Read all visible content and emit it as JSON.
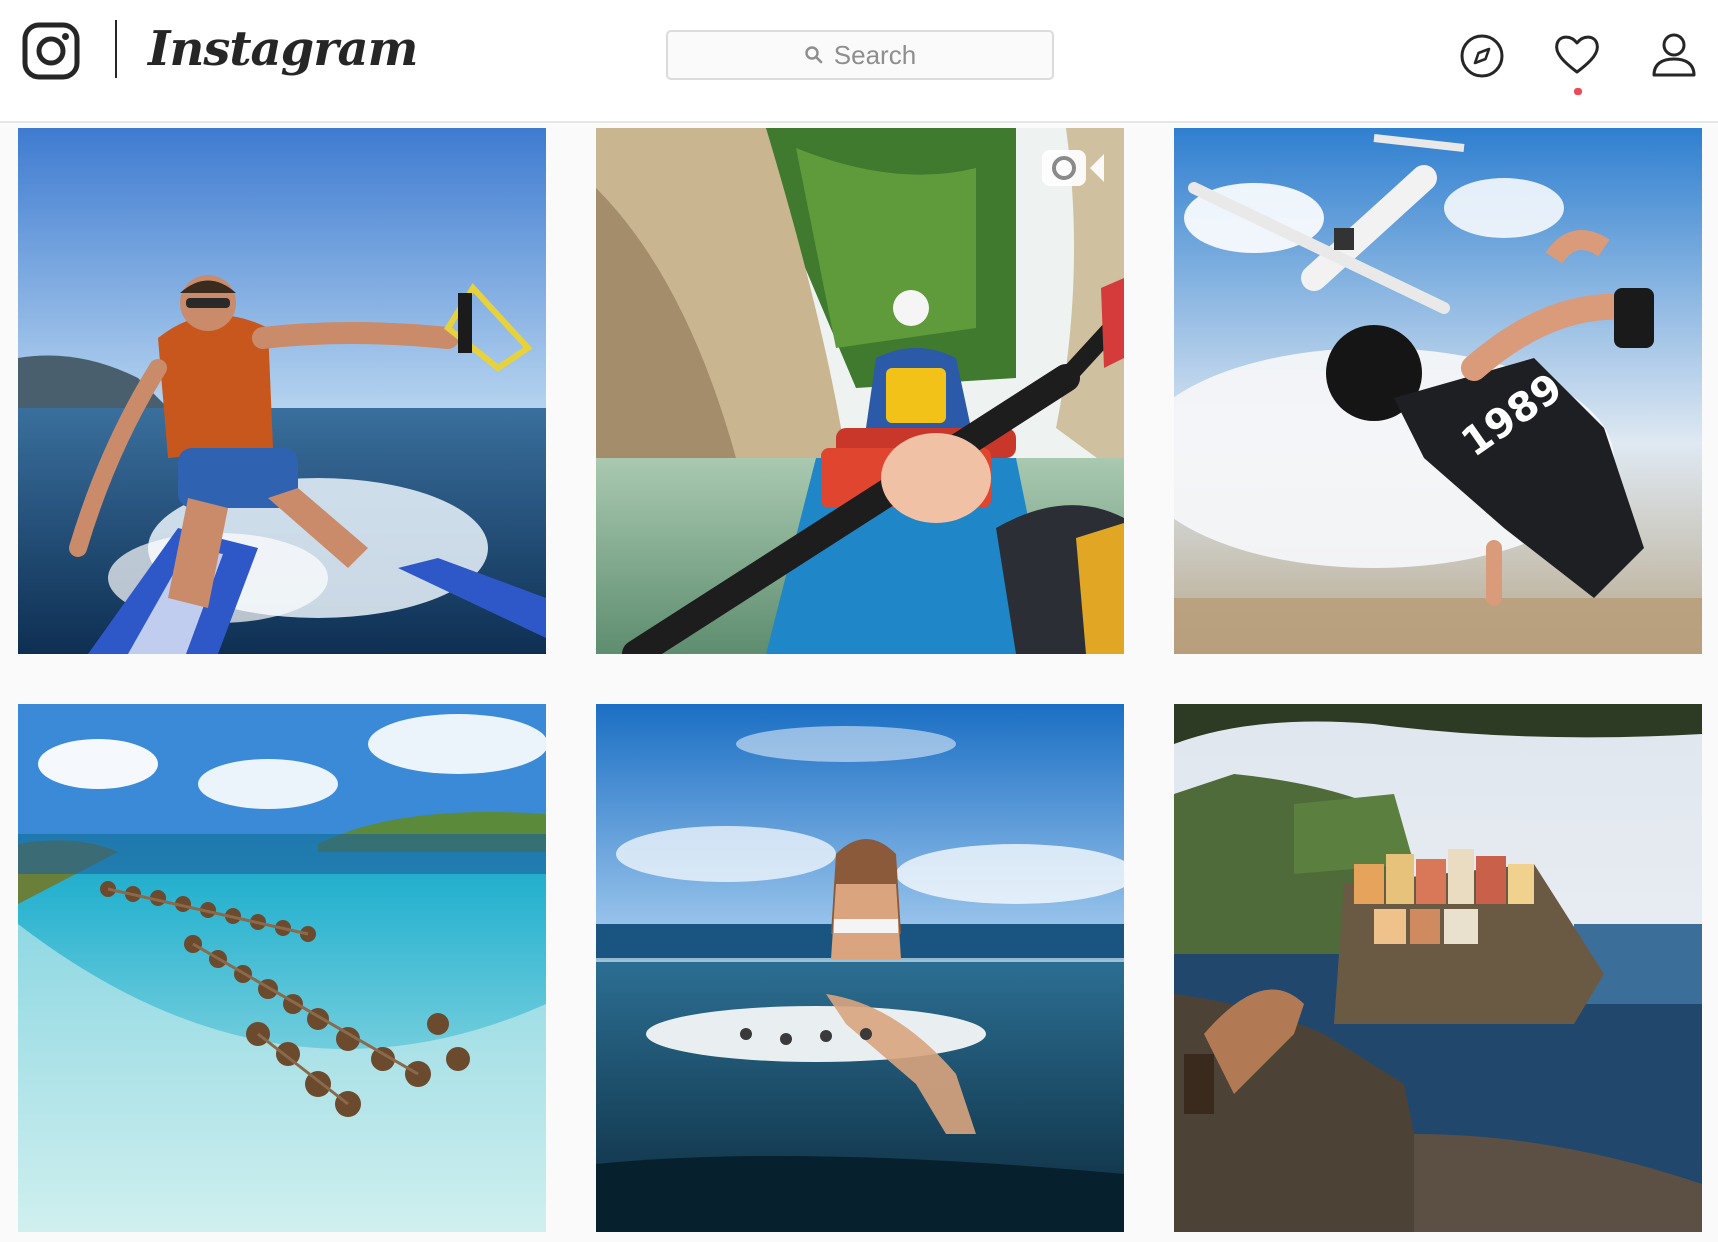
{
  "app": {
    "wordmark": "Instagram"
  },
  "search": {
    "placeholder": "Search"
  },
  "nav": {
    "icons": [
      "instagram-glyph-icon",
      "compass-icon",
      "heart-icon",
      "profile-icon"
    ],
    "has_notification": true
  },
  "colors": {
    "notification": "#ed4956",
    "border": "#dbdbdb",
    "text": "#262626",
    "muted": "#8e8e8e"
  },
  "posts": [
    {
      "type": "image",
      "icons": []
    },
    {
      "type": "video",
      "icons": [
        "video-camera-icon"
      ]
    },
    {
      "type": "image",
      "icons": []
    },
    {
      "type": "image",
      "icons": []
    },
    {
      "type": "image",
      "icons": []
    },
    {
      "type": "image",
      "icons": []
    }
  ]
}
